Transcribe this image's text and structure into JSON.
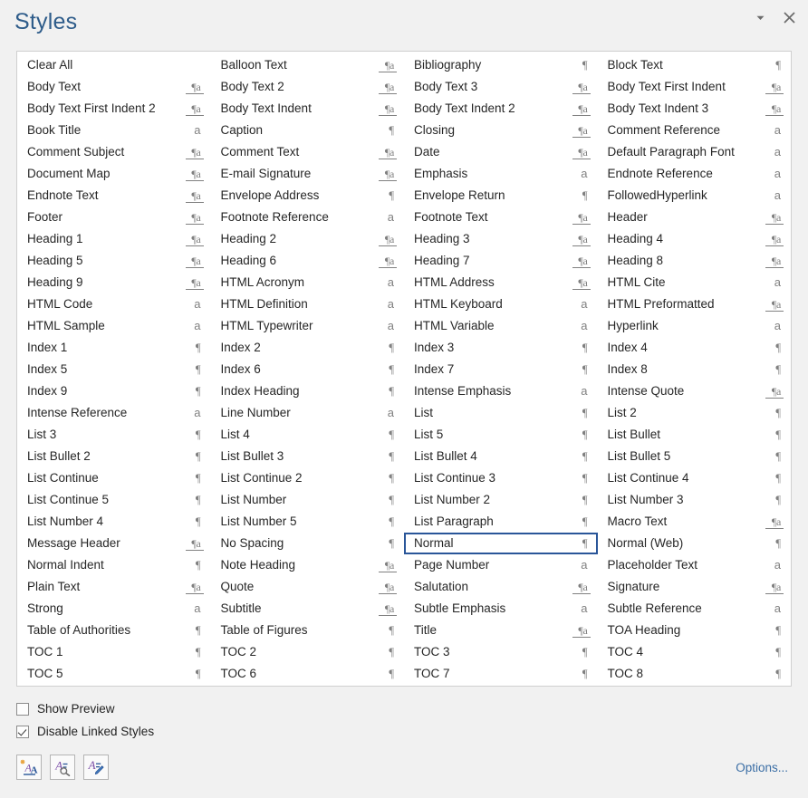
{
  "window": {
    "title": "Styles",
    "minimize_icon": "chevron-down-icon",
    "close_icon": "close-icon",
    "accent_color": "#2e5c8a",
    "selection_border_color": "#2a5699"
  },
  "styles_list": {
    "selected_style": "Normal",
    "icon_legend": {
      "linked": "paragraph-and-character-linked-style-icon",
      "para": "paragraph-style-icon",
      "charc": "character-style-icon",
      "none": "no-style-icon"
    },
    "columns": [
      {
        "index": 1,
        "items": [
          {
            "label": "Clear All",
            "icon": "none"
          },
          {
            "label": "Body Text",
            "icon": "linked"
          },
          {
            "label": "Body Text First Indent 2",
            "icon": "linked"
          },
          {
            "label": "Book Title",
            "icon": "charc"
          },
          {
            "label": "Comment Subject",
            "icon": "linked"
          },
          {
            "label": "Document Map",
            "icon": "linked"
          },
          {
            "label": "Endnote Text",
            "icon": "linked"
          },
          {
            "label": "Footer",
            "icon": "linked"
          },
          {
            "label": "Heading 1",
            "icon": "linked"
          },
          {
            "label": "Heading 5",
            "icon": "linked"
          },
          {
            "label": "Heading 9",
            "icon": "linked"
          },
          {
            "label": "HTML Code",
            "icon": "charc"
          },
          {
            "label": "HTML Sample",
            "icon": "charc"
          },
          {
            "label": "Index 1",
            "icon": "para"
          },
          {
            "label": "Index 5",
            "icon": "para"
          },
          {
            "label": "Index 9",
            "icon": "para"
          },
          {
            "label": "Intense Reference",
            "icon": "charc"
          },
          {
            "label": "List 3",
            "icon": "para"
          },
          {
            "label": "List Bullet 2",
            "icon": "para"
          },
          {
            "label": "List Continue",
            "icon": "para"
          },
          {
            "label": "List Continue 5",
            "icon": "para"
          },
          {
            "label": "List Number 4",
            "icon": "para"
          },
          {
            "label": "Message Header",
            "icon": "linked"
          },
          {
            "label": "Normal Indent",
            "icon": "para"
          },
          {
            "label": "Plain Text",
            "icon": "linked"
          },
          {
            "label": "Strong",
            "icon": "charc"
          },
          {
            "label": "Table of Authorities",
            "icon": "para"
          },
          {
            "label": "TOC 1",
            "icon": "para"
          },
          {
            "label": "TOC 5",
            "icon": "para"
          }
        ]
      },
      {
        "index": 2,
        "items": [
          {
            "label": "Balloon Text",
            "icon": "linked"
          },
          {
            "label": "Body Text 2",
            "icon": "linked"
          },
          {
            "label": "Body Text Indent",
            "icon": "linked"
          },
          {
            "label": "Caption",
            "icon": "para"
          },
          {
            "label": "Comment Text",
            "icon": "linked"
          },
          {
            "label": "E-mail Signature",
            "icon": "linked"
          },
          {
            "label": "Envelope Address",
            "icon": "para"
          },
          {
            "label": "Footnote Reference",
            "icon": "charc"
          },
          {
            "label": "Heading 2",
            "icon": "linked"
          },
          {
            "label": "Heading 6",
            "icon": "linked"
          },
          {
            "label": "HTML Acronym",
            "icon": "charc"
          },
          {
            "label": "HTML Definition",
            "icon": "charc"
          },
          {
            "label": "HTML Typewriter",
            "icon": "charc"
          },
          {
            "label": "Index 2",
            "icon": "para"
          },
          {
            "label": "Index 6",
            "icon": "para"
          },
          {
            "label": "Index Heading",
            "icon": "para"
          },
          {
            "label": "Line Number",
            "icon": "charc"
          },
          {
            "label": "List 4",
            "icon": "para"
          },
          {
            "label": "List Bullet 3",
            "icon": "para"
          },
          {
            "label": "List Continue 2",
            "icon": "para"
          },
          {
            "label": "List Number",
            "icon": "para"
          },
          {
            "label": "List Number 5",
            "icon": "para"
          },
          {
            "label": "No Spacing",
            "icon": "para"
          },
          {
            "label": "Note Heading",
            "icon": "linked"
          },
          {
            "label": "Quote",
            "icon": "linked"
          },
          {
            "label": "Subtitle",
            "icon": "linked"
          },
          {
            "label": "Table of Figures",
            "icon": "para"
          },
          {
            "label": "TOC 2",
            "icon": "para"
          },
          {
            "label": "TOC 6",
            "icon": "para"
          }
        ]
      },
      {
        "index": 3,
        "items": [
          {
            "label": "Bibliography",
            "icon": "para"
          },
          {
            "label": "Body Text 3",
            "icon": "linked"
          },
          {
            "label": "Body Text Indent 2",
            "icon": "linked"
          },
          {
            "label": "Closing",
            "icon": "linked"
          },
          {
            "label": "Date",
            "icon": "linked"
          },
          {
            "label": "Emphasis",
            "icon": "charc"
          },
          {
            "label": "Envelope Return",
            "icon": "para"
          },
          {
            "label": "Footnote Text",
            "icon": "linked"
          },
          {
            "label": "Heading 3",
            "icon": "linked"
          },
          {
            "label": "Heading 7",
            "icon": "linked"
          },
          {
            "label": "HTML Address",
            "icon": "linked"
          },
          {
            "label": "HTML Keyboard",
            "icon": "charc"
          },
          {
            "label": "HTML Variable",
            "icon": "charc"
          },
          {
            "label": "Index 3",
            "icon": "para"
          },
          {
            "label": "Index 7",
            "icon": "para"
          },
          {
            "label": "Intense Emphasis",
            "icon": "charc"
          },
          {
            "label": "List",
            "icon": "para"
          },
          {
            "label": "List 5",
            "icon": "para"
          },
          {
            "label": "List Bullet 4",
            "icon": "para"
          },
          {
            "label": "List Continue 3",
            "icon": "para"
          },
          {
            "label": "List Number 2",
            "icon": "para"
          },
          {
            "label": "List Paragraph",
            "icon": "para"
          },
          {
            "label": "Normal",
            "icon": "para",
            "selected": true
          },
          {
            "label": "Page Number",
            "icon": "charc"
          },
          {
            "label": "Salutation",
            "icon": "linked"
          },
          {
            "label": "Subtle Emphasis",
            "icon": "charc"
          },
          {
            "label": "Title",
            "icon": "linked"
          },
          {
            "label": "TOC 3",
            "icon": "para"
          },
          {
            "label": "TOC 7",
            "icon": "para"
          }
        ]
      },
      {
        "index": 4,
        "items": [
          {
            "label": "Block Text",
            "icon": "para"
          },
          {
            "label": "Body Text First Indent",
            "icon": "linked"
          },
          {
            "label": "Body Text Indent 3",
            "icon": "linked"
          },
          {
            "label": "Comment Reference",
            "icon": "charc"
          },
          {
            "label": "Default Paragraph Font",
            "icon": "charc"
          },
          {
            "label": "Endnote Reference",
            "icon": "charc"
          },
          {
            "label": "FollowedHyperlink",
            "icon": "charc"
          },
          {
            "label": "Header",
            "icon": "linked"
          },
          {
            "label": "Heading 4",
            "icon": "linked"
          },
          {
            "label": "Heading 8",
            "icon": "linked"
          },
          {
            "label": "HTML Cite",
            "icon": "charc"
          },
          {
            "label": "HTML Preformatted",
            "icon": "linked"
          },
          {
            "label": "Hyperlink",
            "icon": "charc"
          },
          {
            "label": "Index 4",
            "icon": "para"
          },
          {
            "label": "Index 8",
            "icon": "para"
          },
          {
            "label": "Intense Quote",
            "icon": "linked"
          },
          {
            "label": "List 2",
            "icon": "para"
          },
          {
            "label": "List Bullet",
            "icon": "para"
          },
          {
            "label": "List Bullet 5",
            "icon": "para"
          },
          {
            "label": "List Continue 4",
            "icon": "para"
          },
          {
            "label": "List Number 3",
            "icon": "para"
          },
          {
            "label": "Macro Text",
            "icon": "linked"
          },
          {
            "label": "Normal (Web)",
            "icon": "para"
          },
          {
            "label": "Placeholder Text",
            "icon": "charc"
          },
          {
            "label": "Signature",
            "icon": "linked"
          },
          {
            "label": "Subtle Reference",
            "icon": "charc"
          },
          {
            "label": "TOA Heading",
            "icon": "para"
          },
          {
            "label": "TOC 4",
            "icon": "para"
          },
          {
            "label": "TOC 8",
            "icon": "para"
          }
        ]
      }
    ]
  },
  "footer": {
    "checkboxes": [
      {
        "label": "Show Preview",
        "checked": false
      },
      {
        "label": "Disable Linked Styles",
        "checked": true
      }
    ],
    "tools": [
      {
        "name": "new-style-button",
        "title": "New Style"
      },
      {
        "name": "style-inspector-button",
        "title": "Style Inspector"
      },
      {
        "name": "manage-styles-button",
        "title": "Manage Styles"
      }
    ],
    "options_label": "Options..."
  }
}
